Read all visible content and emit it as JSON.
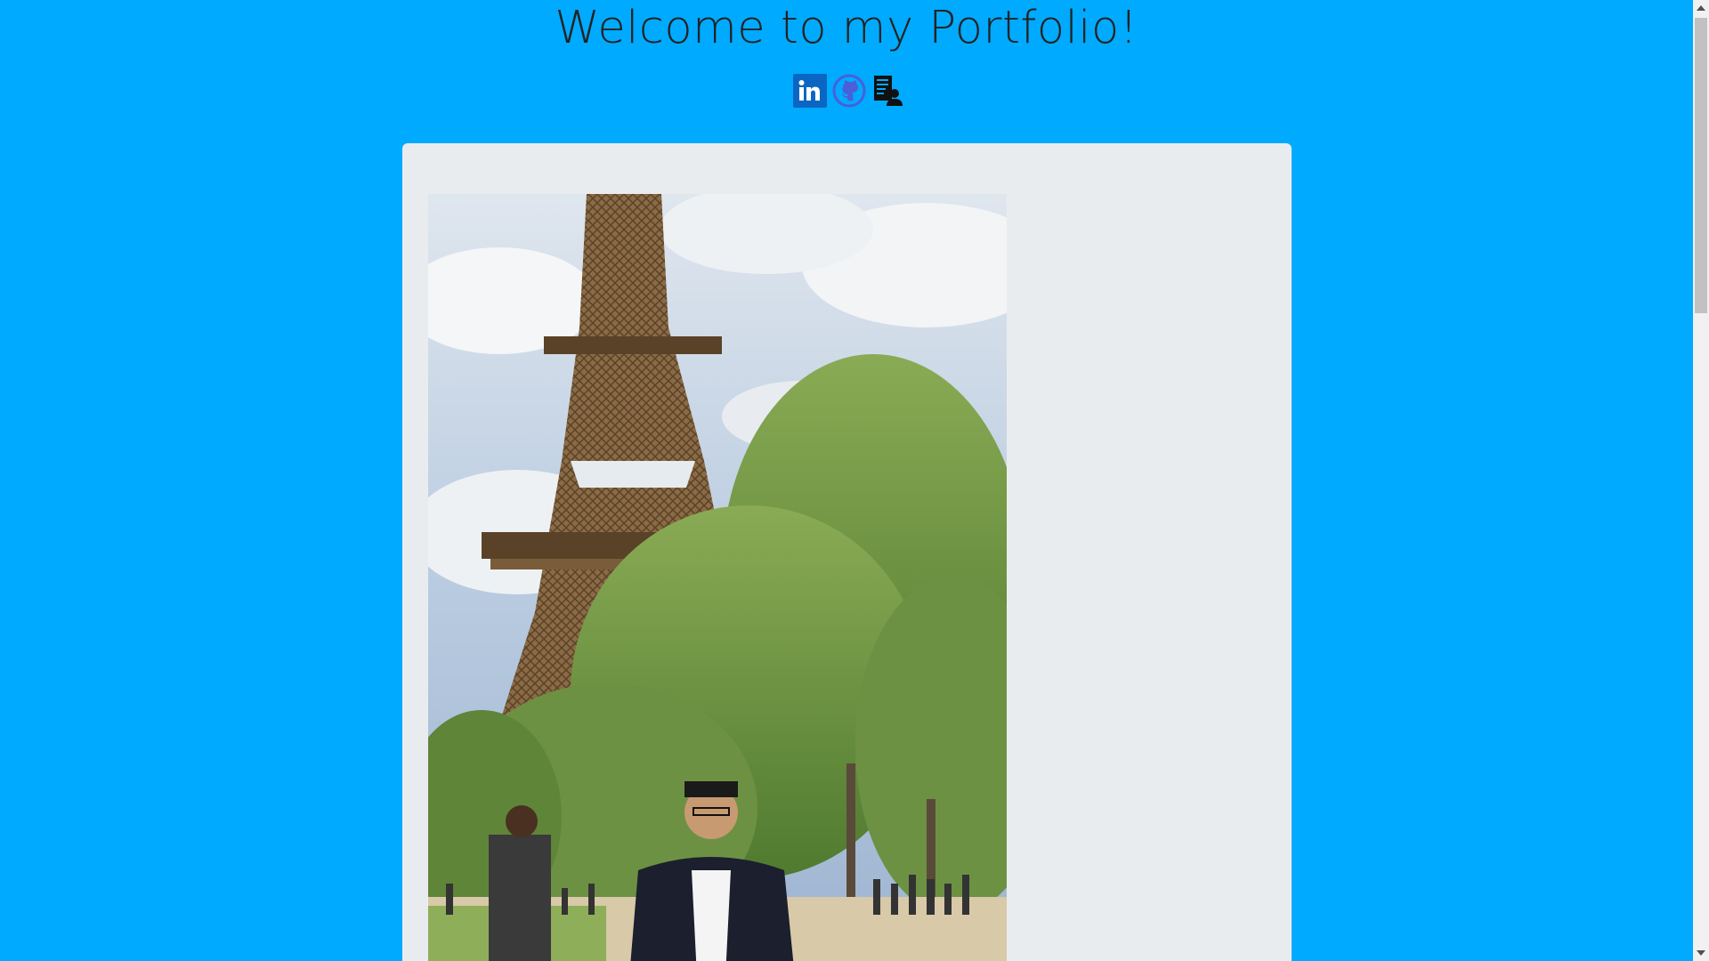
{
  "page": {
    "title": "Welcome to my Portfolio!",
    "background_color": "#00aaff"
  },
  "social_links": [
    {
      "name": "linkedin",
      "icon": "linkedin-icon",
      "text": "in",
      "color": "#0a66c2"
    },
    {
      "name": "github",
      "icon": "github-icon",
      "color": "#4a5fd8"
    },
    {
      "name": "resume",
      "icon": "resume-icon",
      "color": "#111111"
    }
  ],
  "card": {
    "background_color": "#e9ecef",
    "photo_description_icon": "profile-photo"
  }
}
